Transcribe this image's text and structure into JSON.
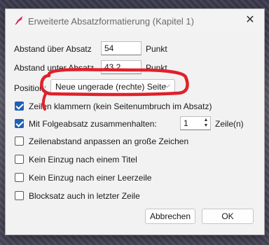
{
  "window": {
    "title": "Erweiterte Absatzformatierung (Kapitel 1)",
    "close_icon": "close-icon"
  },
  "spacing": {
    "above_label": "Abstand über Absatz",
    "above_value": "54",
    "above_unit": "Punkt",
    "below_label": "Abstand unter Absatz",
    "below_value": "43.2",
    "below_unit": "Punkt"
  },
  "position": {
    "label": "Position:",
    "selected": "Neue ungerade (rechte) Seite"
  },
  "options": {
    "keep_lines": {
      "label": "Zeilen klammern (kein Seitenumbruch im Absatz)",
      "checked": true
    },
    "keep_with_next": {
      "label": "Mit Folgeabsatz zusammenhalten:",
      "checked": true,
      "value": "1",
      "unit": "Zeile(n)"
    },
    "line_spacing": {
      "label": "Zeilenabstand anpassen an große Zeichen",
      "checked": false
    },
    "no_indent_title": {
      "label": "Kein Einzug nach einem Titel",
      "checked": false
    },
    "no_indent_blank": {
      "label": "Kein Einzug nach einer Leerzeile",
      "checked": false
    },
    "justify_last": {
      "label": "Blocksatz auch in letzter Zeile",
      "checked": false
    }
  },
  "buttons": {
    "cancel": "Abbrechen",
    "ok": "OK"
  },
  "colors": {
    "annotation": "#e0202a",
    "checkbox_accent": "#1f5fb8"
  }
}
